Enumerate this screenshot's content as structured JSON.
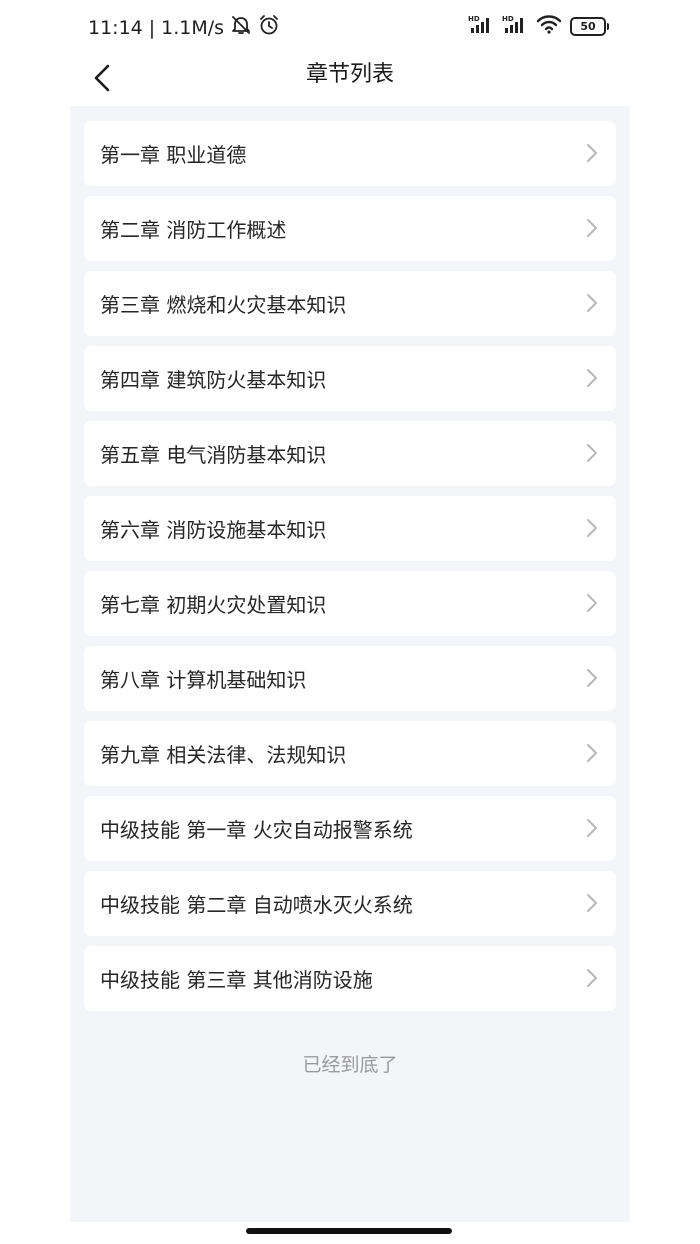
{
  "status_bar": {
    "time": "11:14",
    "separator": "|",
    "net_speed": "1.1M/s",
    "battery": "50",
    "icons": [
      "notification-off-icon",
      "alarm-icon",
      "hd-signal-icon",
      "hd-signal-icon",
      "wifi-icon",
      "battery-icon"
    ]
  },
  "nav": {
    "title": "章节列表",
    "back_icon": "chevron-left-icon"
  },
  "chapters": [
    {
      "label": "第一章 职业道德"
    },
    {
      "label": "第二章 消防工作概述"
    },
    {
      "label": "第三章 燃烧和火灾基本知识"
    },
    {
      "label": "第四章 建筑防火基本知识"
    },
    {
      "label": "第五章 电气消防基本知识"
    },
    {
      "label": "第六章 消防设施基本知识"
    },
    {
      "label": "第七章 初期火灾处置知识"
    },
    {
      "label": "第八章 计算机基础知识"
    },
    {
      "label": "第九章 相关法律、法规知识"
    },
    {
      "label": "中级技能 第一章 火灾自动报警系统"
    },
    {
      "label": "中级技能 第二章 自动喷水灭火系统"
    },
    {
      "label": "中级技能 第三章 其他消防设施"
    }
  ],
  "footer": {
    "end_text": "已经到底了"
  },
  "colors": {
    "background": "#f4f5f9",
    "card": "#ffffff",
    "text": "#262626",
    "muted": "#9a9a9a"
  }
}
